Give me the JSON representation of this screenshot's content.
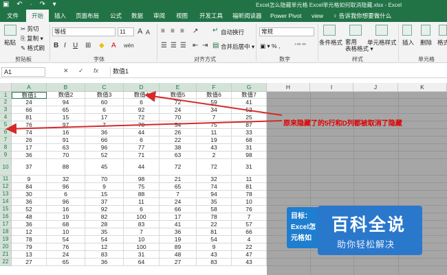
{
  "window": {
    "title": "Excel怎么隐藏单元格 Excel单元格如何取消隐藏.xlsx  -  Excel",
    "quick_access": "▣ ↶ · ↷ ▾"
  },
  "tabs": [
    {
      "label": "文件"
    },
    {
      "label": "开始"
    },
    {
      "label": "插入"
    },
    {
      "label": "页面布局"
    },
    {
      "label": "公式"
    },
    {
      "label": "数据"
    },
    {
      "label": "审阅"
    },
    {
      "label": "视图"
    },
    {
      "label": "开发工具"
    },
    {
      "label": "福昕阅读器"
    },
    {
      "label": "Power Pivot"
    },
    {
      "label": "view"
    }
  ],
  "active_tab": "开始",
  "tell_me": "♀ 告诉我你想要做什么",
  "ribbon": {
    "clipboard": {
      "paste": "粘贴",
      "cut": "✂ 剪切",
      "copy": "⎘ 复制 ▾",
      "format_painter": "✎ 格式刷",
      "label": "剪贴板"
    },
    "font": {
      "name": "等线",
      "size": "11",
      "grow": "A",
      "shrink": "A",
      "bold": "B",
      "italic": "I",
      "underline": "U",
      "pinyin": "wén",
      "label": "字体"
    },
    "alignment": {
      "wrap": "自动换行",
      "merge": "合并后居中 ▾",
      "label": "对齐方式"
    },
    "number": {
      "format": "常规",
      "currency": "▣ ▾ % ,",
      "decimals": "⁺⁰⁰ ⁰⁰",
      "label": "数字"
    },
    "styles": {
      "conditional": "条件格式",
      "table": "套用\n表格格式 ▾",
      "cell_styles": "单元格样式",
      "label": "样式"
    },
    "cells": {
      "insert": "插入",
      "delete": "删除",
      "format": "格式",
      "label": "单元格"
    }
  },
  "formula_bar": {
    "name_box": "A1",
    "cancel": "✕",
    "confirm": "✓",
    "fx": "fx",
    "content": "数值1"
  },
  "grid": {
    "columns": [
      "A",
      "B",
      "C",
      "D",
      "E",
      "F",
      "G",
      "H",
      "I",
      "J",
      "K"
    ],
    "rows": [
      {
        "num": "1",
        "cells": [
          "数值1",
          "数值2",
          "数值3",
          "数值4",
          "数值5",
          "数值6",
          "数值7"
        ]
      },
      {
        "num": "2",
        "cells": [
          "24",
          "94",
          "60",
          "6",
          "72",
          "59",
          "41"
        ]
      },
      {
        "num": "3",
        "cells": [
          "66",
          "65",
          "6",
          "92",
          "24",
          "34",
          "52"
        ]
      },
      {
        "num": "4",
        "cells": [
          "81",
          "15",
          "17",
          "72",
          "70",
          "7",
          "25"
        ]
      },
      {
        "num": "5",
        "cells": [
          "76",
          "97",
          "7",
          "70",
          "54",
          "75",
          "87"
        ]
      },
      {
        "num": "6",
        "cells": [
          "74",
          "16",
          "36",
          "44",
          "26",
          "11",
          "33"
        ]
      },
      {
        "num": "7",
        "cells": [
          "26",
          "91",
          "66",
          "6",
          "22",
          "19",
          "68"
        ]
      },
      {
        "num": "8",
        "cells": [
          "17",
          "63",
          "96",
          "77",
          "38",
          "43",
          "31"
        ]
      },
      {
        "num": "9",
        "cells": [
          "36",
          "70",
          "52",
          "71",
          "63",
          "2",
          "98"
        ]
      },
      {
        "num": "10",
        "cells": [
          "37",
          "88",
          "45",
          "44",
          "72",
          "72",
          "31"
        ]
      },
      {
        "num": "11",
        "cells": [
          "9",
          "32",
          "70",
          "98",
          "21",
          "32",
          "11"
        ]
      },
      {
        "num": "12",
        "cells": [
          "84",
          "96",
          "9",
          "75",
          "65",
          "74",
          "81"
        ]
      },
      {
        "num": "13",
        "cells": [
          "30",
          "6",
          "15",
          "88",
          "7",
          "94",
          "78"
        ]
      },
      {
        "num": "14",
        "cells": [
          "36",
          "96",
          "37",
          "11",
          "24",
          "35",
          "10"
        ]
      },
      {
        "num": "15",
        "cells": [
          "52",
          "16",
          "92",
          "6",
          "66",
          "58",
          "76"
        ]
      },
      {
        "num": "16",
        "cells": [
          "48",
          "19",
          "82",
          "100",
          "17",
          "78",
          "7"
        ]
      },
      {
        "num": "17",
        "cells": [
          "36",
          "68",
          "28",
          "83",
          "41",
          "22",
          "57"
        ]
      },
      {
        "num": "18",
        "cells": [
          "12",
          "10",
          "35",
          "7",
          "36",
          "81",
          "66"
        ]
      },
      {
        "num": "19",
        "cells": [
          "78",
          "54",
          "54",
          "10",
          "19",
          "54",
          "4"
        ]
      },
      {
        "num": "20",
        "cells": [
          "79",
          "76",
          "12",
          "100",
          "89",
          "9",
          "22"
        ]
      },
      {
        "num": "21",
        "cells": [
          "13",
          "24",
          "83",
          "31",
          "48",
          "43",
          "47"
        ]
      },
      {
        "num": "22",
        "cells": [
          "27",
          "65",
          "36",
          "64",
          "27",
          "83",
          "43"
        ]
      }
    ]
  },
  "annotation": "原来隐藏了的5行和D列都被取消了隐藏",
  "tip_box": {
    "line1": "目标：",
    "line2": "Excel怎",
    "line3": "元格如"
  },
  "watermark": {
    "title": "百科全说",
    "subtitle": "助你轻松解决"
  },
  "colors": {
    "excel_green": "#217346",
    "annotation_red": "#e00000",
    "arrow_red": "#d42a2a",
    "watermark_blue": "#2a78cc"
  }
}
